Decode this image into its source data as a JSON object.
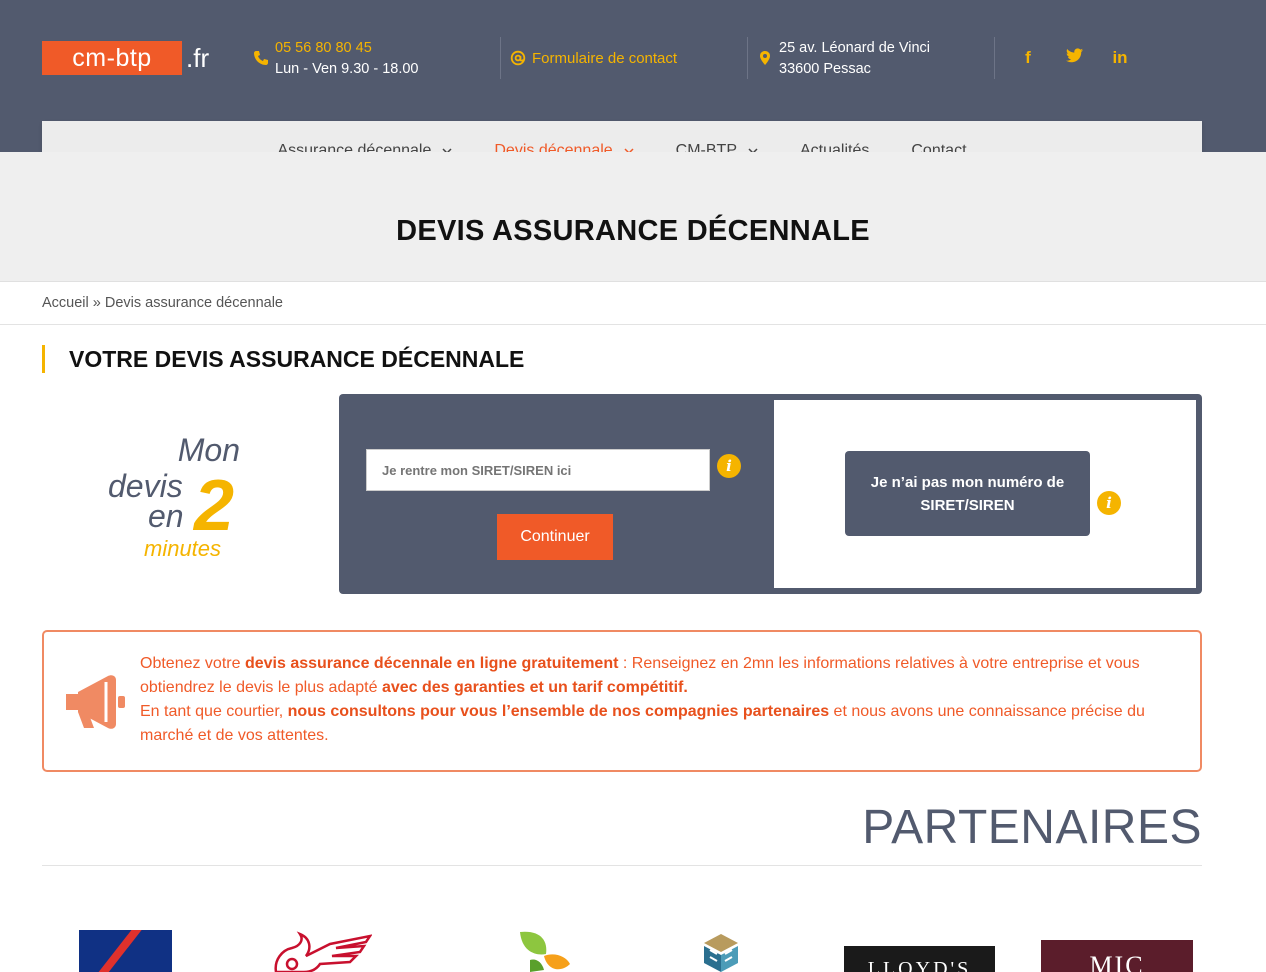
{
  "header": {
    "logo_main": "cm-btp",
    "logo_tld": ".fr",
    "phone": "05 56 80 80 45",
    "hours": "Lun - Ven 9.30 - 18.00",
    "contact_form_label": "Formulaire de contact",
    "address_line1": "25 av. Léonard de Vinci",
    "address_line2": "33600 Pessac",
    "social": {
      "facebook": "f",
      "twitter": "🐦",
      "linkedin": "in"
    },
    "accent_color": "#f5b400",
    "bg_color": "#525a6e"
  },
  "nav": {
    "items": [
      {
        "label": "Assurance décennale",
        "has_dropdown": true,
        "active": false
      },
      {
        "label": "Devis décennale",
        "has_dropdown": true,
        "active": true
      },
      {
        "label": "CM-BTP",
        "has_dropdown": true,
        "active": false
      },
      {
        "label": "Actualités",
        "has_dropdown": false,
        "active": false
      },
      {
        "label": "Contact",
        "has_dropdown": false,
        "active": false
      }
    ]
  },
  "page": {
    "title": "DEVIS ASSURANCE DÉCENNALE",
    "breadcrumb": "Accueil » Devis assurance décennale",
    "section_title": "VOTRE DEVIS ASSURANCE DÉCENNALE"
  },
  "promo": {
    "mon": "Mon",
    "devis": "devis",
    "en": "en",
    "two": "2",
    "minutes": "minutes"
  },
  "form": {
    "siret_placeholder": "Je rentre mon SIRET/SIREN ici",
    "continue_label": "Continuer",
    "no_siret_label": "Je n’ai pas mon numéro de SIRET/SIREN",
    "info_symbol": "i",
    "primary_color": "#f05a28"
  },
  "notice": {
    "p1_a": "Obtenez votre ",
    "p1_b": "devis assurance décennale en ligne gratuitement",
    "p1_c": " : Renseignez en 2mn les informations relatives à votre entreprise et vous obtiendrez le devis le plus adapté ",
    "p1_d": "avec des garanties et un tarif compétitif.",
    "p2_a": "En tant que courtier, ",
    "p2_b": "nous consultons pour vous l’ensemble de nos compagnies partenaires",
    "p2_c": " et nous avons une connaissance précise du marché et de vos attentes."
  },
  "partners": {
    "title": "PARTENAIRES",
    "logos": [
      "axa-logo",
      "generali-logo",
      "leaf-logo",
      "cube-logo",
      "lloyds-logo",
      "mic-logo"
    ],
    "lloyds_text": "LLOYD'S",
    "mic_text": "MIC"
  }
}
